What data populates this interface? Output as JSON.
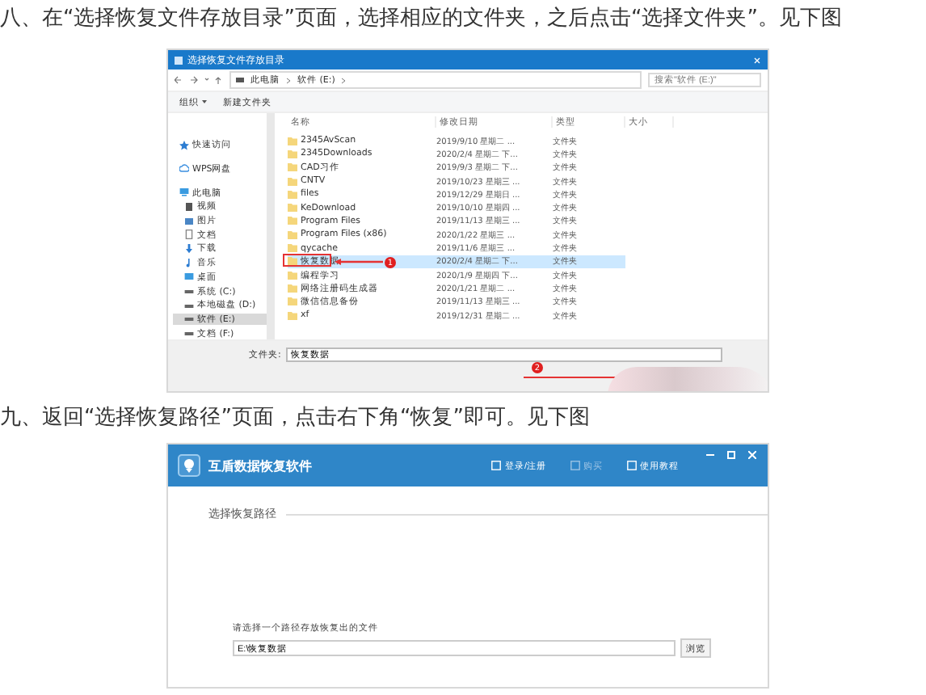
{
  "steps": [
    {
      "text": "八、在“选择恢复文件存放目录”页面，选择相应的文件夹，之后点击“选择文件夹”。见下图"
    },
    {
      "text": "九、返回“选择恢复路径”页面，点击右下角“恢复”即可。见下图"
    }
  ],
  "folder_dialog": {
    "title": "选择恢复文件存放目录",
    "path": [
      "此电脑",
      "软件 (E:)"
    ],
    "search": {
      "placeholder": "搜索\"软件 (E:)\""
    },
    "toolbar": [
      "组织",
      "新建文件夹"
    ],
    "nav": [
      {
        "label": "快速访问",
        "kind": "star",
        "selected": false
      },
      {
        "label": "WPS网盘",
        "kind": "cloud",
        "selected": false
      },
      {
        "label": "此电脑",
        "kind": "pc",
        "selected": false,
        "children": [
          {
            "label": "视频",
            "kind": "video",
            "selected": false
          },
          {
            "label": "图片",
            "kind": "image",
            "selected": false
          },
          {
            "label": "文档",
            "kind": "doc",
            "selected": false
          },
          {
            "label": "下载",
            "kind": "download",
            "selected": false
          },
          {
            "label": "音乐",
            "kind": "music",
            "selected": false
          },
          {
            "label": "桌面",
            "kind": "desktop",
            "selected": false
          },
          {
            "label": "系统 (C:)",
            "kind": "drive",
            "selected": false
          },
          {
            "label": "本地磁盘 (D:)",
            "kind": "drive",
            "selected": false
          },
          {
            "label": "软件 (E:)",
            "kind": "drive",
            "selected": true
          },
          {
            "label": "文档 (F:)",
            "kind": "drive",
            "selected": false
          }
        ]
      }
    ],
    "columns": [
      "名称",
      "修改日期",
      "类型",
      "大小"
    ],
    "rows": [
      {
        "name": "2345AvScan",
        "date": "2019/9/10 星期二 ...",
        "type": "文件夹",
        "selected": false
      },
      {
        "name": "2345Downloads",
        "date": "2020/2/4 星期二 下...",
        "type": "文件夹",
        "selected": false
      },
      {
        "name": "CAD习作",
        "date": "2019/9/3 星期二 下...",
        "type": "文件夹",
        "selected": false
      },
      {
        "name": "CNTV",
        "date": "2019/10/23 星期三 ...",
        "type": "文件夹",
        "selected": false
      },
      {
        "name": "files",
        "date": "2019/12/29 星期日 ...",
        "type": "文件夹",
        "selected": false
      },
      {
        "name": "KeDownload",
        "date": "2019/10/10 星期四 ...",
        "type": "文件夹",
        "selected": false
      },
      {
        "name": "Program Files",
        "date": "2019/11/13 星期三 ...",
        "type": "文件夹",
        "selected": false
      },
      {
        "name": "Program Files (x86)",
        "date": "2020/1/22 星期三 ...",
        "type": "文件夹",
        "selected": false
      },
      {
        "name": "qycache",
        "date": "2019/11/6 星期三 ...",
        "type": "文件夹",
        "selected": false
      },
      {
        "name": "恢复数据",
        "date": "2020/2/4 星期二 下...",
        "type": "文件夹",
        "selected": true
      },
      {
        "name": "编程学习",
        "date": "2020/1/9 星期四 下...",
        "type": "文件夹",
        "selected": false
      },
      {
        "name": "网络注册码生成器",
        "date": "2020/1/21 星期二 ...",
        "type": "文件夹",
        "selected": false
      },
      {
        "name": "微信信息备份",
        "date": "2019/11/13 星期三 ...",
        "type": "文件夹",
        "selected": false
      },
      {
        "name": "xf",
        "date": "2019/12/31 星期二 ...",
        "type": "文件夹",
        "selected": false
      }
    ],
    "folder_label": "文件夹:",
    "folder_value": "恢复数据",
    "callouts": [
      "1",
      "2"
    ]
  },
  "recovery_app": {
    "title": "互盾数据恢复软件",
    "nav": [
      {
        "label": "登录/注册",
        "disabled": false
      },
      {
        "label": "购买",
        "disabled": true
      },
      {
        "label": "使用教程",
        "disabled": false
      }
    ],
    "section_title": "选择恢复路径",
    "prompt": "请选择一个路径存放恢复出的文件",
    "path_value": "E:\\恢复数据",
    "browse_button": "浏览"
  }
}
